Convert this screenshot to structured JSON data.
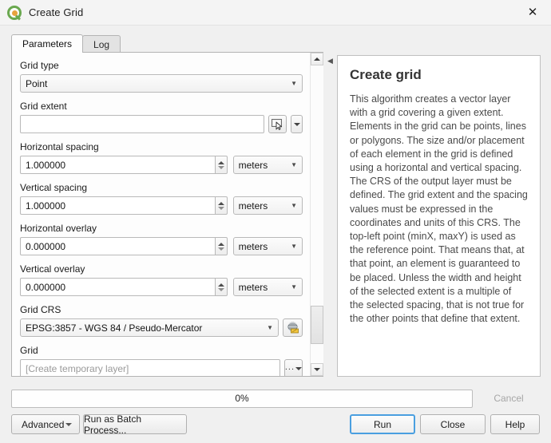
{
  "window": {
    "title": "Create Grid",
    "app_icon": "qgis-logo-icon",
    "close_icon": "✕"
  },
  "tabs": [
    {
      "label": "Parameters",
      "active": true
    },
    {
      "label": "Log",
      "active": false
    }
  ],
  "parameters": {
    "grid_type": {
      "label": "Grid type",
      "value": "Point"
    },
    "grid_extent": {
      "label": "Grid extent",
      "value": "",
      "placeholder": "",
      "select_icon": "map-select-cursor-icon",
      "dropdown_icon": "chevron-down-icon"
    },
    "horizontal_spacing": {
      "label": "Horizontal spacing",
      "value": "1.000000",
      "unit": "meters"
    },
    "vertical_spacing": {
      "label": "Vertical spacing",
      "value": "1.000000",
      "unit": "meters"
    },
    "horizontal_overlay": {
      "label": "Horizontal overlay",
      "value": "0.000000",
      "unit": "meters"
    },
    "vertical_overlay": {
      "label": "Vertical overlay",
      "value": "0.000000",
      "unit": "meters"
    },
    "grid_crs": {
      "label": "Grid CRS",
      "value": "EPSG:3857 - WGS 84 / Pseudo-Mercator",
      "picker_icon": "crs-globe-icon"
    },
    "grid_output": {
      "label": "Grid",
      "value": "",
      "placeholder": "[Create temporary layer]",
      "browse_label": "..."
    }
  },
  "help": {
    "title": "Create grid",
    "text": "This algorithm creates a vector layer with a grid covering a given extent. Elements in the grid can be points, lines or polygons. The size and/or placement of each element in the grid is defined using a horizontal and vertical spacing. The CRS of the output layer must be defined. The grid extent and the spacing values must be expressed in the coordinates and units of this CRS. The top-left point (minX, maxY) is used as the reference point. That means that, at that point, an element is guaranteed to be placed. Unless the width and height of the selected extent is a multiple of the selected spacing, that is not true for the other points that define that extent."
  },
  "progress": {
    "percent_label": "0%",
    "value": 0
  },
  "buttons": {
    "cancel": "Cancel",
    "advanced": "Advanced",
    "batch": "Run as Batch Process...",
    "run": "Run",
    "close": "Close",
    "help": "Help"
  },
  "colors": {
    "accent_focus": "#4a9fe0",
    "qgis_green": "#6aa84f",
    "qgis_orange": "#e8a33d",
    "window_bg": "#f0f0f0",
    "panel_bg": "#fdfdfd",
    "disabled_text": "#a6a6a6"
  }
}
